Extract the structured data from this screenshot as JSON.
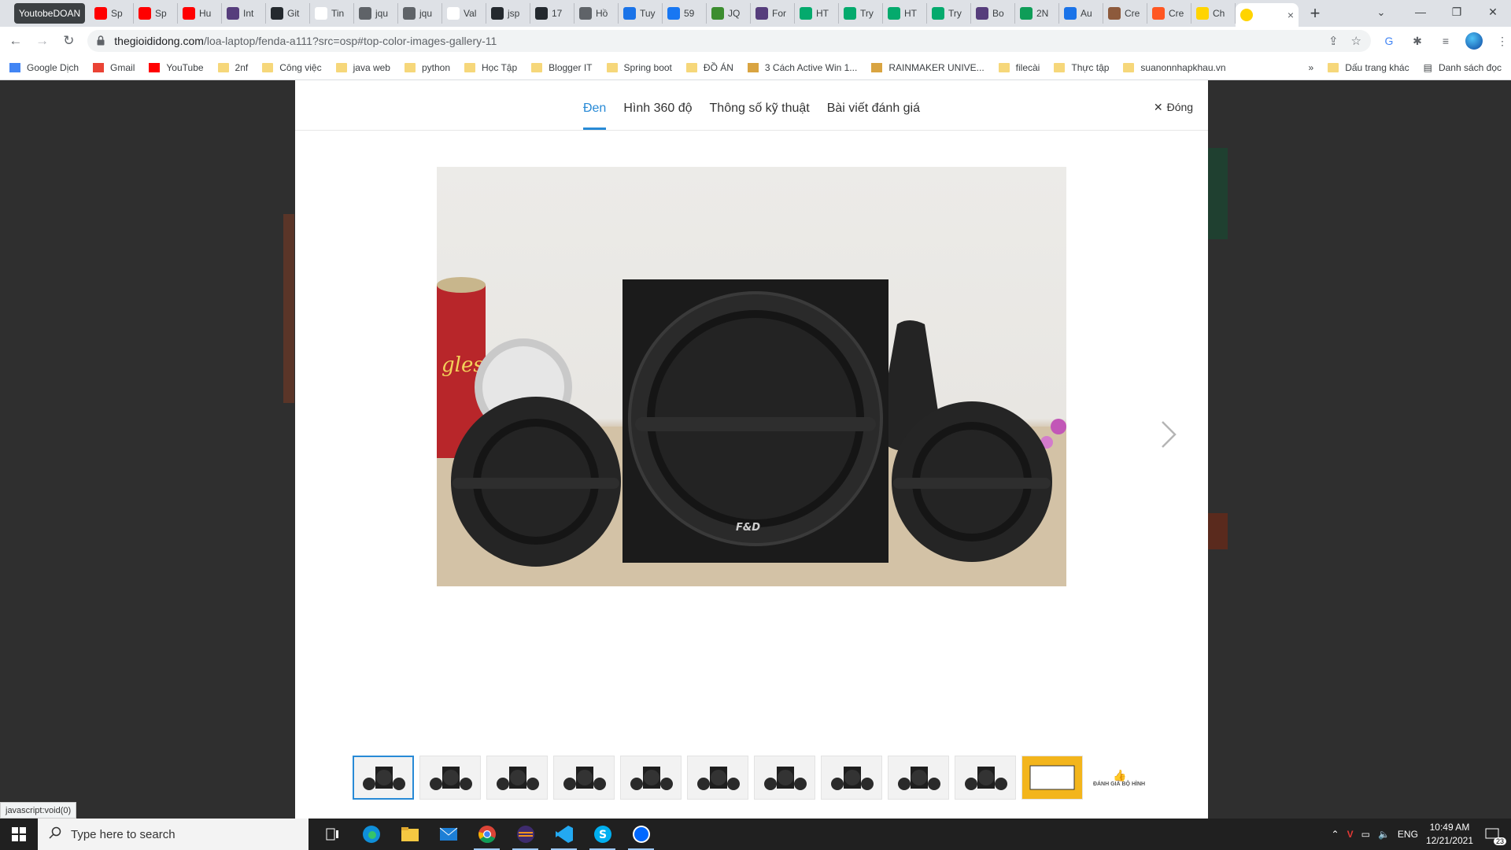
{
  "browser": {
    "tabs": [
      {
        "label": "YoutobeDOAN",
        "icon": "youtube-icon"
      },
      {
        "label": "Sp",
        "icon": "youtube-icon"
      },
      {
        "label": "Sp",
        "icon": "youtube-icon"
      },
      {
        "label": "Hu",
        "icon": "youtube-icon"
      },
      {
        "label": "Int",
        "icon": "bootstrap-icon"
      },
      {
        "label": "Git",
        "icon": "github-icon"
      },
      {
        "label": "Tin",
        "icon": "v-icon"
      },
      {
        "label": "jqu",
        "icon": "globe-icon"
      },
      {
        "label": "jqu",
        "icon": "globe-icon"
      },
      {
        "label": "Val",
        "icon": "v-icon"
      },
      {
        "label": "jsp",
        "icon": "github-icon"
      },
      {
        "label": "17",
        "icon": "github-icon"
      },
      {
        "label": "Hồ",
        "icon": "globe-icon"
      },
      {
        "label": "Tuy",
        "icon": "cloud-icon"
      },
      {
        "label": "59",
        "icon": "facebook-icon"
      },
      {
        "label": "JQ",
        "icon": "js-icon"
      },
      {
        "label": "For",
        "icon": "bootstrap-icon"
      },
      {
        "label": "HT",
        "icon": "w3-icon"
      },
      {
        "label": "Try",
        "icon": "w3-icon"
      },
      {
        "label": "HT",
        "icon": "w3-icon"
      },
      {
        "label": "Try",
        "icon": "w3-icon"
      },
      {
        "label": "Bo",
        "icon": "bootstrap-icon"
      },
      {
        "label": "2N",
        "icon": "sheets-icon"
      },
      {
        "label": "Au",
        "icon": "cloud-icon"
      },
      {
        "label": "Cre",
        "icon": "avatar-icon"
      },
      {
        "label": "Cre",
        "icon": "blogger-icon"
      },
      {
        "label": "Ch",
        "icon": "tgdd-icon"
      }
    ],
    "active_tab_close": "×",
    "new_tab": "+",
    "url_host": "thegioididong.com",
    "url_rest": "/loa-laptop/fenda-a111?src=osp#top-color-images-gallery-11",
    "bookmarks": [
      {
        "label": "Google Dịch",
        "icon": "translate-icon"
      },
      {
        "label": "Gmail",
        "icon": "gmail-icon"
      },
      {
        "label": "YouTube",
        "icon": "youtube-icon"
      },
      {
        "label": "2nf",
        "icon": "folder-icon"
      },
      {
        "label": "Công việc",
        "icon": "folder-icon"
      },
      {
        "label": "java web",
        "icon": "folder-icon"
      },
      {
        "label": "python",
        "icon": "folder-icon"
      },
      {
        "label": "Học Tập",
        "icon": "folder-icon"
      },
      {
        "label": "Blogger IT",
        "icon": "folder-icon"
      },
      {
        "label": "Spring boot",
        "icon": "folder-icon"
      },
      {
        "label": "ĐỒ ÁN",
        "icon": "folder-icon"
      },
      {
        "label": "3 Cách Active Win 1...",
        "icon": "page-icon"
      },
      {
        "label": "RAINMAKER UNIVE...",
        "icon": "page-icon"
      },
      {
        "label": "filecài",
        "icon": "folder-icon"
      },
      {
        "label": "Thực tập",
        "icon": "folder-icon"
      },
      {
        "label": "suanonnhapkhau.vn",
        "icon": "folder-icon"
      }
    ],
    "bookmarks_more": "»",
    "other_bookmarks": "Dấu trang khác",
    "reading_list": "Danh sách đọc"
  },
  "modal": {
    "tabs": [
      "Đen",
      "Hình 360 độ",
      "Thông số kỹ thuật",
      "Bài viết đánh giá"
    ],
    "close_label": "Đóng",
    "photo_logo": "F&D",
    "review_thumb_label": "ĐÁNH GIÁ BỘ HÌNH"
  },
  "status_text": "javascript:void(0)",
  "taskbar": {
    "search_placeholder": "Type here to search",
    "lang": "ENG",
    "time": "10:49 AM",
    "date": "12/21/2021",
    "notif_count": "23"
  },
  "colors": {
    "accent": "#288ad6",
    "taskbar": "#202020",
    "overlay": "#2f2f2f"
  }
}
